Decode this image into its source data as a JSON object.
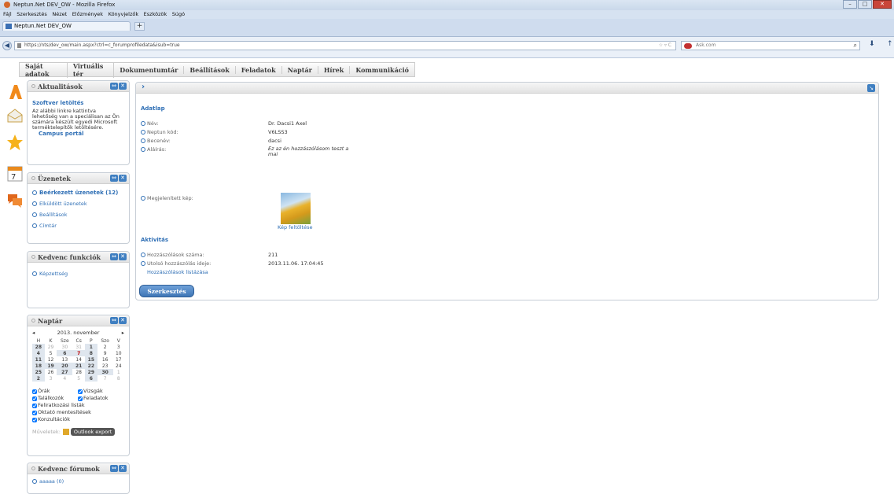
{
  "window": {
    "title": "Neptun.Net DEV_OW - Mozilla Firefox"
  },
  "menu": [
    "Fájl",
    "Szerkesztés",
    "Nézet",
    "Előzmények",
    "Könyvjelzők",
    "Eszközök",
    "Súgó"
  ],
  "tab": {
    "title": "Neptun.Net DEV_OW",
    "new_tab": "+"
  },
  "address": {
    "url": "https://nts/dev_ow/main.aspx?ctrl=c_forumprofiledata&isub=true",
    "right": "☆ ▿ C"
  },
  "search": {
    "placeholder": "Ask.com"
  },
  "site_nav": [
    "Saját adatok",
    "Virtuális tér",
    "Dokumentumtár",
    "Beállítások",
    "Feladatok",
    "Naptár",
    "Hírek",
    "Kommunikáció"
  ],
  "panels": {
    "aktualitasok": {
      "title": "Aktualitások",
      "link": "Szoftver letöltés",
      "text": "Az alábbi linkre kattintva lehetőség van a speciálisan az Ön számára készült egyedi Microsoft terméktelepítők letöltésére.",
      "portal": "Campus portál"
    },
    "uzenetek": {
      "title": "Üzenetek",
      "items": [
        "Beérkezett üzenetek (12)",
        "Elküldött üzenetek",
        "Beállítások",
        "Címtár"
      ]
    },
    "kedvenc": {
      "title": "Kedvenc funkciók",
      "items": [
        "Képzettség"
      ]
    },
    "naptar": {
      "title": "Naptár",
      "month": "2013. november",
      "weekdays": [
        "H",
        "K",
        "Sze",
        "Cs",
        "P",
        "Szo",
        "V"
      ],
      "rows": [
        [
          "28",
          "29",
          "30",
          "31",
          "1",
          "2",
          "3"
        ],
        [
          "4",
          "5",
          "6",
          "7",
          "8",
          "9",
          "10"
        ],
        [
          "11",
          "12",
          "13",
          "14",
          "15",
          "16",
          "17"
        ],
        [
          "18",
          "19",
          "20",
          "21",
          "22",
          "23",
          "24"
        ],
        [
          "25",
          "26",
          "27",
          "28",
          "29",
          "30",
          "1"
        ],
        [
          "2",
          "3",
          "4",
          "5",
          "6",
          "7",
          "8"
        ]
      ],
      "checks": [
        "Órák",
        "Vizsgák",
        "Találkozók",
        "Feladatok",
        "Feliratkozási listák",
        "Oktató mentesítések",
        "Konzultációk"
      ],
      "muveletek": "Műveletek:",
      "outlook": "Outlook export"
    },
    "forumok": {
      "title": "Kedvenc fórumok",
      "items": [
        "aaaaa (0)"
      ]
    }
  },
  "main": {
    "adatlap": "Adatlap",
    "fields": [
      {
        "label": "Név:",
        "value": "Dr. Dacsi1 Axel"
      },
      {
        "label": "Neptun kód:",
        "value": "V6LSS3"
      },
      {
        "label": "Becenév:",
        "value": "dacsi"
      },
      {
        "label": "Aláírás:",
        "value": "Ez az én hozzászólásom teszt a mai"
      }
    ],
    "kep_label": "Megjelenített kép:",
    "kep_link": "Kép feltöltése",
    "aktivitas": "Aktivitás",
    "act_fields": [
      {
        "label": "Hozzászólások száma:",
        "value": "211"
      },
      {
        "label": "Utolsó hozzászólás ideje:",
        "value": "2013.11.06. 17:04:45"
      }
    ],
    "list_link": "Hozzászólások listázása",
    "edit": "Szerkesztés"
  }
}
